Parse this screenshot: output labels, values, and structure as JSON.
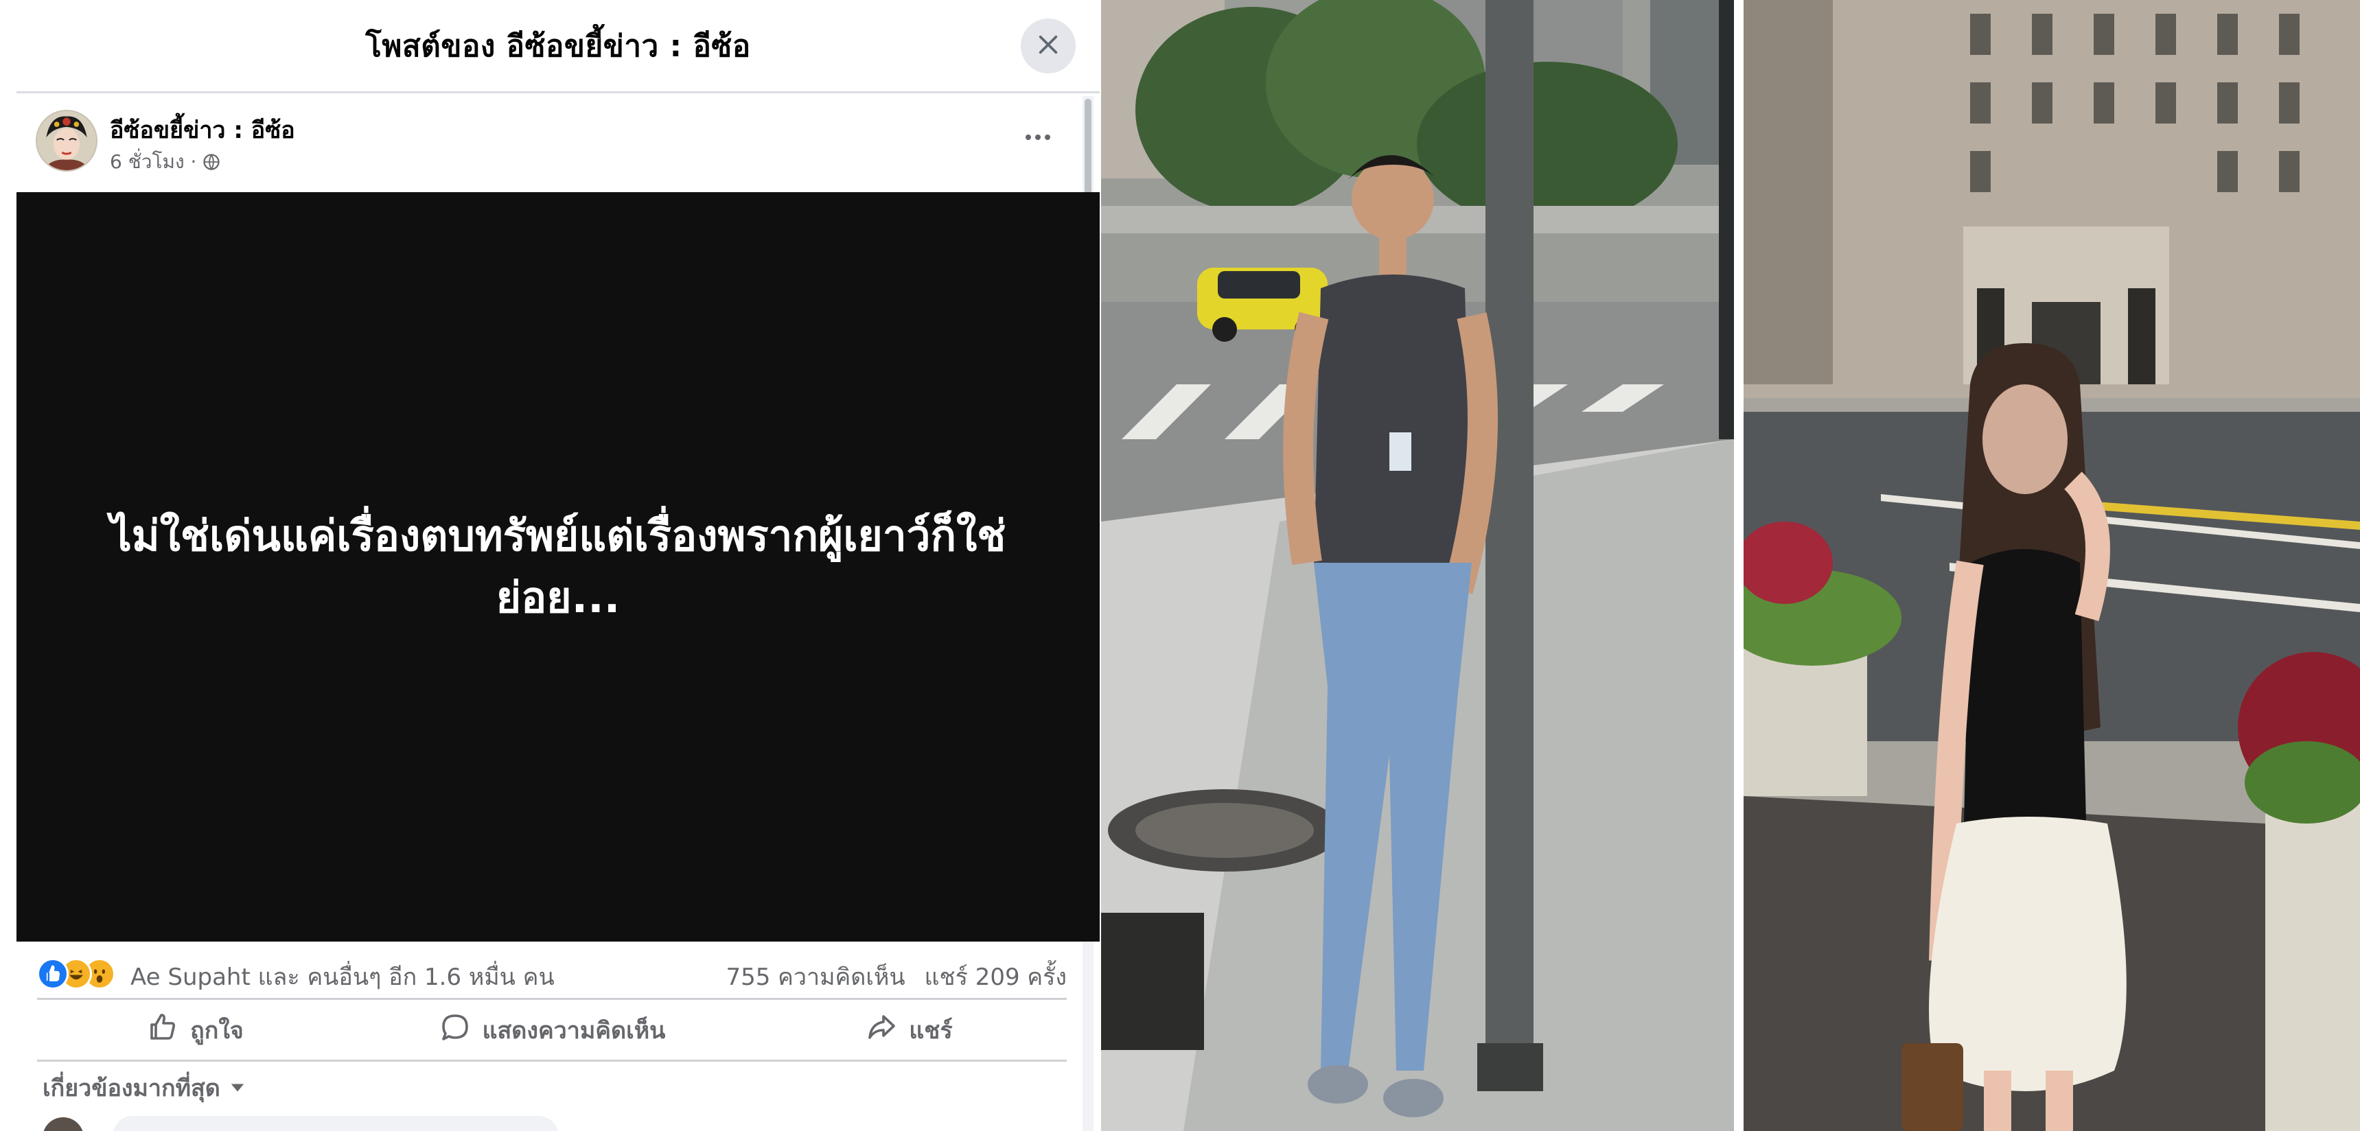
{
  "dialog": {
    "title": "โพสต์ของ อีซ้อขยี้ข่าว : อีซ้อ",
    "close_icon": "close-icon"
  },
  "post": {
    "author": "อีซ้อขยี้ข่าว : อีซ้อ",
    "time": "6 ชั่วโมง ·",
    "privacy_icon": "globe-icon",
    "more_icon": "more-options-icon",
    "image_text": "ไม่ใช่เด่นแค่เรื่องตบทรัพย์แต่เรื่องพรากผู้เยาว์ก็ใช่ย่อย..."
  },
  "reactions": {
    "icons": [
      "like-reaction-icon",
      "haha-reaction-icon",
      "wow-reaction-icon"
    ],
    "colors": {
      "like": "#1877f2",
      "haha": "#f7b125",
      "wow": "#f7b125"
    },
    "label": "Ae Supaht และ คนอื่นๆ อีก 1.6 หมื่น คน",
    "comments": "755 ความคิดเห็น",
    "shares": "แชร์ 209 ครั้ง"
  },
  "actions": {
    "like": "ถูกใจ",
    "comment": "แสดงความคิดเห็น",
    "share": "แชร์"
  },
  "comments_filter": {
    "label": "เกี่ยวข้องมากที่สุด"
  },
  "photos": [
    {
      "name": "photo-man-street"
    },
    {
      "name": "photo-woman-street"
    }
  ]
}
